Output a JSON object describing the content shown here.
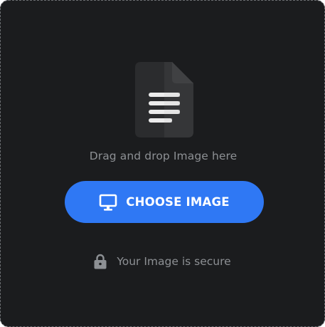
{
  "upload": {
    "icon": "document-icon",
    "drop_text": "Drag and drop Image here",
    "choose_button": {
      "label": "CHOOSE IMAGE",
      "icon": "monitor-icon",
      "color": "#2f78f4"
    },
    "security_note": {
      "icon": "lock-icon",
      "text": "Your Image is secure"
    }
  },
  "colors": {
    "background": "#1b1c1e",
    "dashed_border": "#6b6e72",
    "muted_text": "#8d9094",
    "accent": "#2f78f4"
  }
}
